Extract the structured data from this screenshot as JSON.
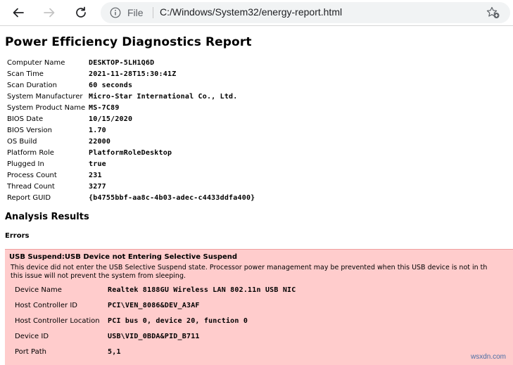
{
  "browser": {
    "address_scheme": "File",
    "address_url": "C:/Windows/System32/energy-report.html"
  },
  "report": {
    "title": "Power Efficiency Diagnostics Report",
    "system_info": [
      {
        "label": "Computer Name",
        "value": "DESKTOP-5LH1Q6D"
      },
      {
        "label": "Scan Time",
        "value": "2021-11-28T15:30:41Z"
      },
      {
        "label": "Scan Duration",
        "value": "60 seconds"
      },
      {
        "label": "System Manufacturer",
        "value": "Micro-Star International Co., Ltd."
      },
      {
        "label": "System Product Name",
        "value": "MS-7C89"
      },
      {
        "label": "BIOS Date",
        "value": "10/15/2020"
      },
      {
        "label": "BIOS Version",
        "value": "1.70"
      },
      {
        "label": "OS Build",
        "value": "22000"
      },
      {
        "label": "Platform Role",
        "value": "PlatformRoleDesktop"
      },
      {
        "label": "Plugged In",
        "value": "true"
      },
      {
        "label": "Process Count",
        "value": "231"
      },
      {
        "label": "Thread Count",
        "value": "3277"
      },
      {
        "label": "Report GUID",
        "value": "{b4755bbf-aa8c-4b03-adec-c4433ddfa400}"
      }
    ],
    "analysis_heading": "Analysis Results",
    "errors_heading": "Errors",
    "error": {
      "title": "USB Suspend:USB Device not Entering Selective Suspend",
      "description_line1": "This device did not enter the USB Selective Suspend state. Processor power management may be prevented when this USB device is not in th",
      "description_line2": "this issue will not prevent the system from sleeping.",
      "details": [
        {
          "label": "Device Name",
          "value": "Realtek 8188GU Wireless LAN 802.11n USB NIC"
        },
        {
          "label": "Host Controller ID",
          "value": "PCI\\VEN_8086&DEV_A3AF"
        },
        {
          "label": "Host Controller Location",
          "value": "PCI bus 0, device 20, function 0"
        },
        {
          "label": "Device ID",
          "value": "USB\\VID_0BDA&PID_B711"
        },
        {
          "label": "Port Path",
          "value": "5,1"
        }
      ]
    }
  },
  "watermark": "wsxdn.com",
  "colors": {
    "error_background": "#ffcccc",
    "address_bar": "#f1f3f4"
  },
  "icons": [
    "back-arrow-icon",
    "forward-arrow-icon",
    "refresh-icon",
    "info-icon",
    "add-favorite-icon"
  ]
}
